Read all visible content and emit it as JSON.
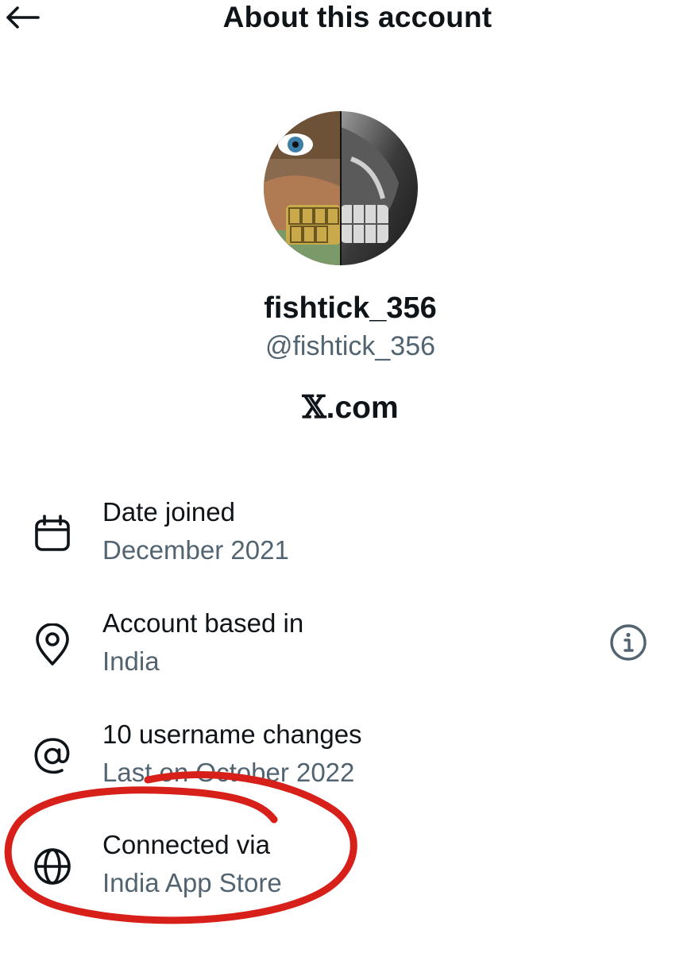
{
  "header": {
    "title": "About this account"
  },
  "profile": {
    "display_name": "fishtick_356",
    "handle": "@fishtick_356",
    "verified_site_mark": "𝕏",
    "verified_site_text": ".com"
  },
  "details": [
    {
      "icon": "calendar-icon",
      "label": "Date joined",
      "value": "December 2021"
    },
    {
      "icon": "location-pin-icon",
      "label": "Account based in",
      "value": "India"
    },
    {
      "icon": "at-sign-icon",
      "label": "10 username changes",
      "value": "Last on October 2022"
    },
    {
      "icon": "globe-icon",
      "label": "Connected via",
      "value": "India App Store"
    }
  ],
  "colors": {
    "text_primary": "#0f1419",
    "text_secondary": "#536471",
    "annotation_red": "#d8201a"
  }
}
